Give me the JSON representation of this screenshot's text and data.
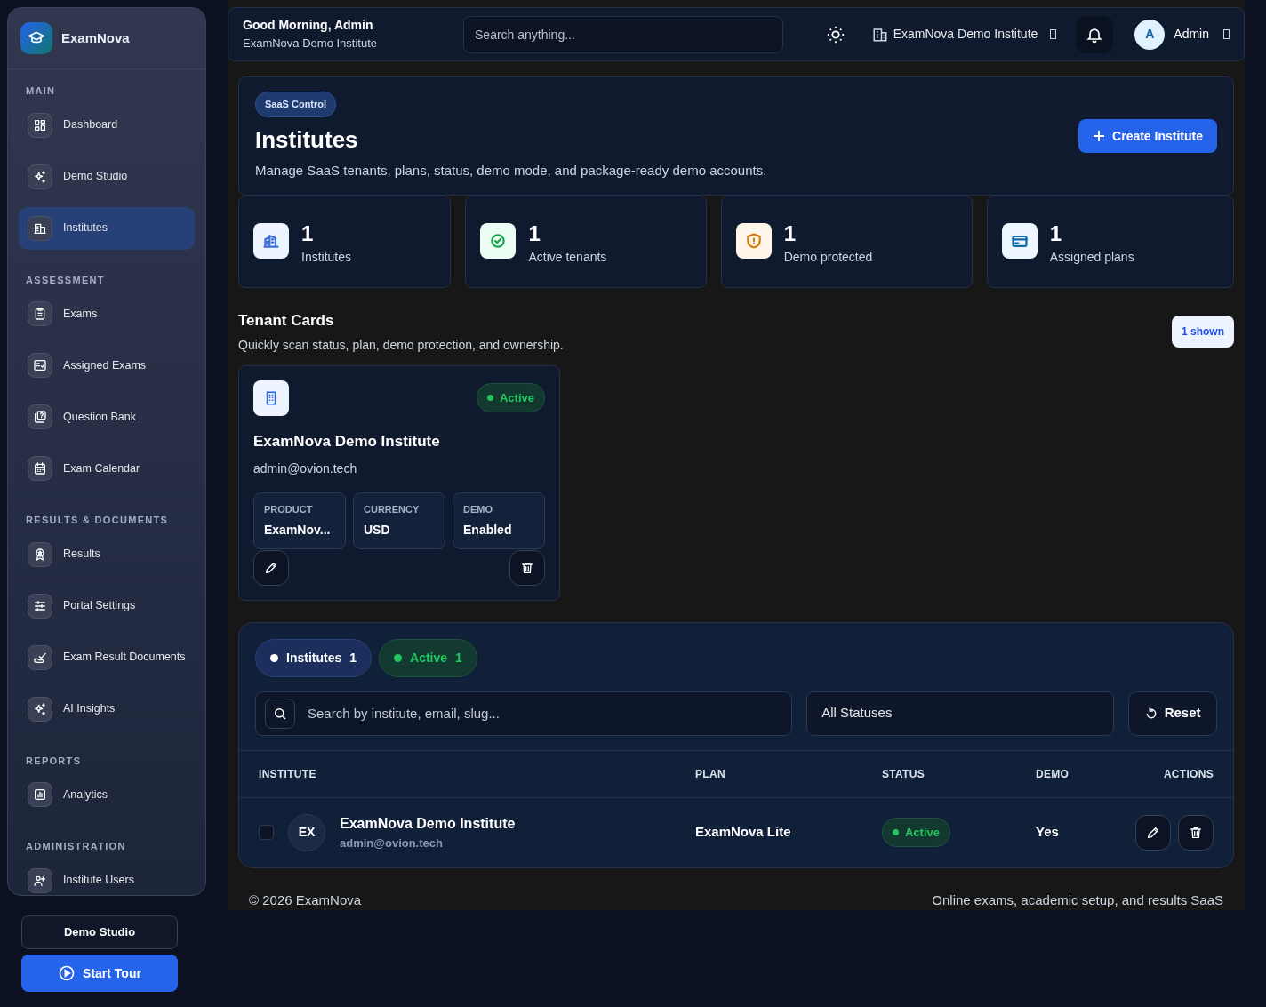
{
  "brand": {
    "name": "ExamNova"
  },
  "sidebar": {
    "sections": [
      {
        "title": "MAIN",
        "items": [
          {
            "label": "Dashboard",
            "selected": false
          },
          {
            "label": "Demo Studio",
            "selected": false
          },
          {
            "label": "Institutes",
            "selected": true
          }
        ]
      },
      {
        "title": "ASSESSMENT",
        "items": [
          {
            "label": "Exams",
            "selected": false
          },
          {
            "label": "Assigned Exams",
            "selected": false
          },
          {
            "label": "Question Bank",
            "selected": false
          },
          {
            "label": "Exam Calendar",
            "selected": false
          }
        ]
      },
      {
        "title": "RESULTS & DOCUMENTS",
        "items": [
          {
            "label": "Results",
            "selected": false
          },
          {
            "label": "Portal Settings",
            "selected": false
          },
          {
            "label": "Exam Result Documents",
            "selected": false
          },
          {
            "label": "AI Insights",
            "selected": false
          }
        ]
      },
      {
        "title": "REPORTS",
        "items": [
          {
            "label": "Analytics",
            "selected": false
          }
        ]
      },
      {
        "title": "ADMINISTRATION",
        "items": [
          {
            "label": "Institute Users",
            "selected": false
          }
        ]
      }
    ],
    "demo_button": "Demo Studio",
    "tour_button": "Start Tour"
  },
  "header": {
    "greeting": "Good Morning, Admin",
    "subtitle": "ExamNova Demo Institute",
    "search": {
      "placeholder": "Search anything..."
    },
    "institute_switcher": "ExamNova Demo Institute",
    "user": {
      "initial": "A",
      "name": "Admin"
    }
  },
  "hero": {
    "badge": "SaaS Control",
    "title": "Institutes",
    "description": "Manage SaaS tenants, plans, status, demo mode, and package-ready demo accounts.",
    "button": "Create Institute"
  },
  "stats": [
    {
      "value": "1",
      "label": "Institutes",
      "color": "#3b6fd8"
    },
    {
      "value": "1",
      "label": "Active tenants",
      "color": "#16a34a"
    },
    {
      "value": "1",
      "label": "Demo protected",
      "color": "#d97706"
    },
    {
      "value": "1",
      "label": "Assigned plans",
      "color": "#0e6aa8"
    }
  ],
  "tenant_section": {
    "title": "Tenant Cards",
    "subtitle": "Quickly scan status, plan, demo protection, and ownership.",
    "count_badge": "1 shown"
  },
  "tenant_cards": [
    {
      "name": "ExamNova Demo Institute",
      "email": "admin@ovion.tech",
      "status": "Active",
      "active": true,
      "fields": [
        {
          "label": "PRODUCT",
          "value": "ExamNov..."
        },
        {
          "label": "CURRENCY",
          "value": "USD"
        },
        {
          "label": "DEMO",
          "value": "Enabled"
        }
      ]
    }
  ],
  "filters": {
    "chips": [
      {
        "label": "Institutes",
        "count": "1",
        "color": "#ffffff"
      },
      {
        "label": "Active",
        "count": "1",
        "color": "#22c55e"
      }
    ],
    "search": {
      "placeholder": "Search by institute, email, slug..."
    },
    "status_select": "All Statuses",
    "reset": "Reset"
  },
  "table": {
    "columns": [
      "INSTITUTE",
      "PLAN",
      "STATUS",
      "DEMO",
      "ACTIONS"
    ],
    "rows": [
      {
        "checked": false,
        "initials": "EX",
        "name": "ExamNova Demo Institute",
        "email": "admin@ovion.tech",
        "plan": "ExamNova Lite",
        "status": "Active",
        "active": true,
        "demo": "Yes"
      }
    ]
  },
  "footer": {
    "left": "© 2026 ExamNova",
    "right": "Online exams, academic setup, and results SaaS"
  }
}
